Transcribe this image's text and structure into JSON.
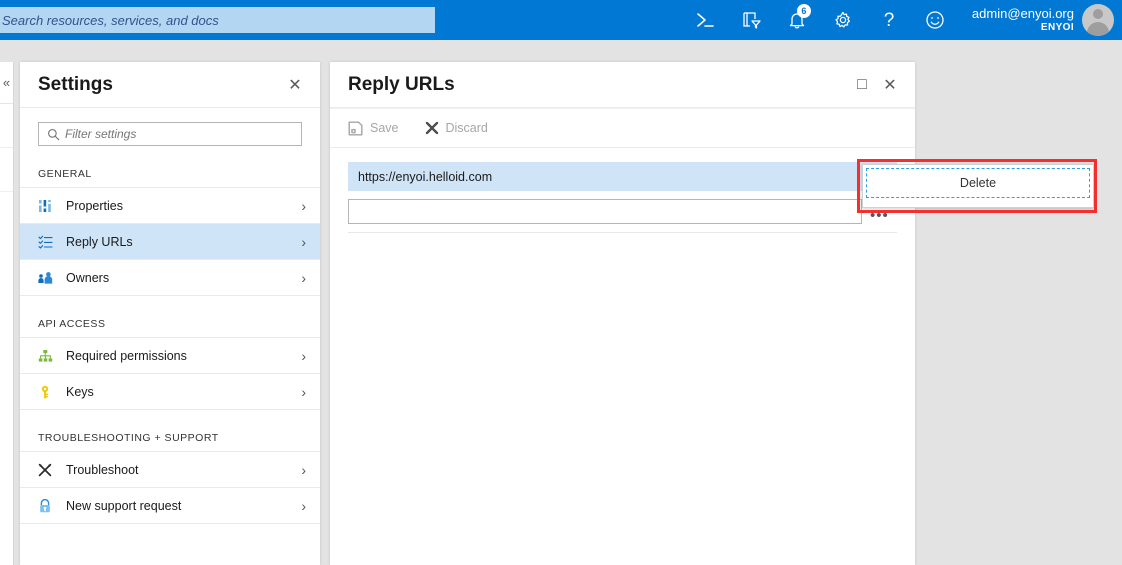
{
  "header": {
    "search_placeholder": "Search resources, services, and docs",
    "icons": [
      {
        "name": "cloud-shell-icon",
        "glyph": ">_"
      },
      {
        "name": "directory-filter-icon",
        "glyph": "filter"
      },
      {
        "name": "notifications-bell-icon",
        "glyph": "bell",
        "badge": "6"
      },
      {
        "name": "settings-gear-icon",
        "glyph": "gear"
      },
      {
        "name": "help-question-icon",
        "glyph": "?"
      },
      {
        "name": "feedback-smiley-icon",
        "glyph": "smiley"
      }
    ],
    "account": {
      "email": "admin@enyoi.org",
      "directory": "ENYOI"
    }
  },
  "settings_blade": {
    "title": "Settings",
    "close_label": "✕",
    "filter_placeholder": "Filter settings",
    "groups": [
      {
        "label": "GENERAL",
        "items": [
          {
            "label": "Properties",
            "icon": "sliders-icon",
            "selected": false
          },
          {
            "label": "Reply URLs",
            "icon": "list-icon",
            "selected": true
          },
          {
            "label": "Owners",
            "icon": "owners-icon",
            "selected": false
          }
        ]
      },
      {
        "label": "API ACCESS",
        "items": [
          {
            "label": "Required permissions",
            "icon": "hierarchy-icon",
            "selected": false
          },
          {
            "label": "Keys",
            "icon": "key-icon",
            "selected": false
          }
        ]
      },
      {
        "label": "TROUBLESHOOTING + SUPPORT",
        "items": [
          {
            "label": "Troubleshoot",
            "icon": "tools-icon",
            "selected": false
          },
          {
            "label": "New support request",
            "icon": "support-icon",
            "selected": false
          }
        ]
      }
    ],
    "chevron": "›"
  },
  "reply_blade": {
    "title": "Reply URLs",
    "maximize_label": "□",
    "close_label": "✕",
    "toolbar": {
      "save_label": "Save",
      "discard_label": "Discard"
    },
    "urls": [
      {
        "value": "https://enyoi.helloid.com",
        "selected": true
      }
    ],
    "new_url_value": "",
    "ellipsis_label": "•••"
  },
  "context_menu": {
    "delete_label": "Delete"
  },
  "blade_stub": {
    "collapse_label": "«"
  },
  "colors": {
    "azure_blue": "#0078d4",
    "search_fill": "#b3d7f2",
    "row_highlight": "#cfe4f7",
    "annotation_red": "#f4302e",
    "focus_dashed_blue": "#2aa3e8",
    "page_background": "#e3e3e3"
  }
}
